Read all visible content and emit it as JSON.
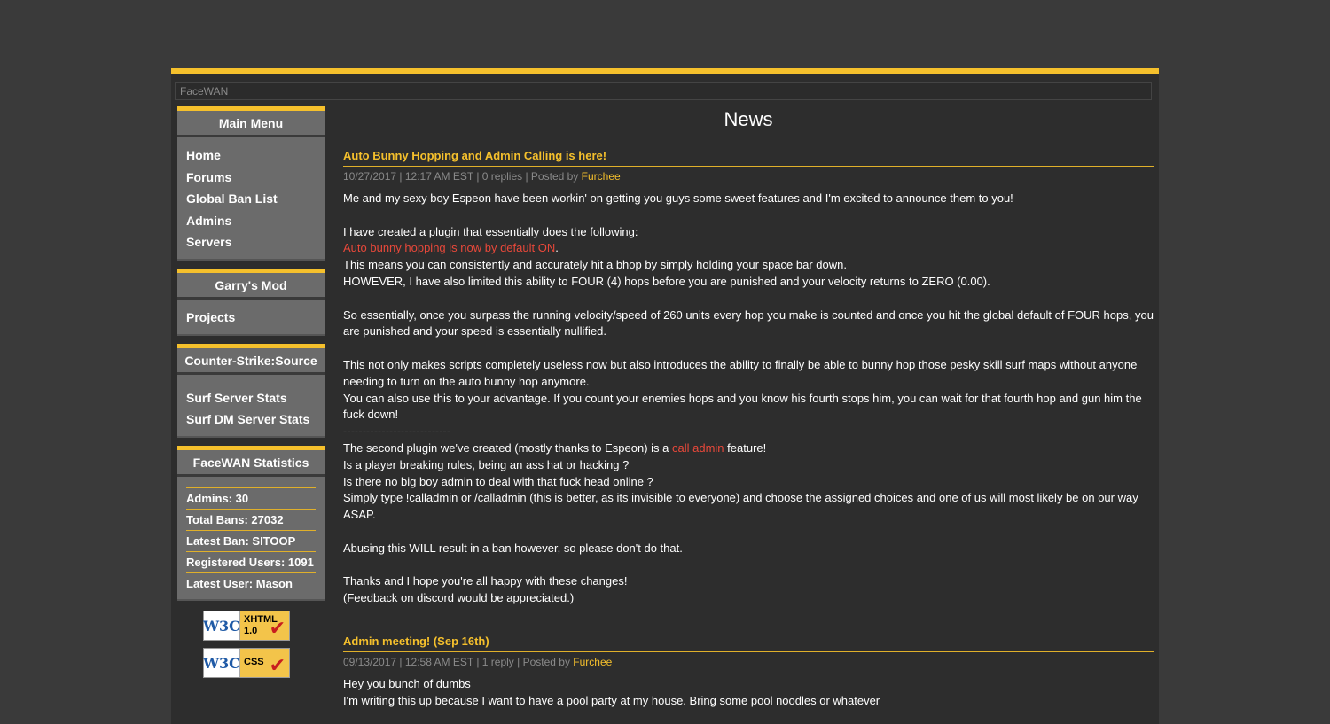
{
  "breadcrumb": "FaceWAN",
  "menus": {
    "main": {
      "title": "Main Menu",
      "items": [
        "Home",
        "Forums",
        "Global Ban List",
        "Admins",
        "Servers"
      ]
    },
    "garrys": {
      "title": "Garry's Mod",
      "items": [
        "Projects"
      ]
    },
    "css": {
      "title": "Counter-Strike:Source",
      "items": [
        "Surf Server Stats",
        "Surf DM Server Stats"
      ]
    },
    "stats": {
      "title": "FaceWAN Statistics",
      "items": [
        "Admins: 30",
        "Total Bans: 27032",
        "Latest Ban: SITOOP",
        "Registered Users: 1091",
        "Latest User: Mason"
      ]
    }
  },
  "badges": {
    "xhtml": {
      "logo": "W3C",
      "label1": "XHTML",
      "label2": "1.0"
    },
    "css": {
      "logo": "W3C",
      "label1": "CSS",
      "label2": ""
    }
  },
  "page_title": "News",
  "posts": [
    {
      "title": "Auto Bunny Hopping and Admin Calling is here!",
      "meta": "10/27/2017 | 12:17 AM EST | 0 replies | Posted by ",
      "author": "Furchee",
      "lines": {
        "p1": "Me and my sexy boy Espeon have been workin' on getting you guys some sweet features and I'm excited to announce them to you!",
        "p2": "I have created a plugin that essentially does the following:",
        "p3_red": "Auto bunny hopping is now by default ON",
        "p3_end": ".",
        "p4": "This means you can consistently and accurately hit a bhop by simply holding your space bar down.",
        "p5": "HOWEVER, I have also limited this ability to FOUR (4) hops before you are punished and your velocity returns to ZERO (0.00).",
        "p6": "So essentially, once you surpass the running velocity/speed of 260 units every hop you make is counted and once you hit the global default of FOUR hops, you are punished and your speed is essentially nullified.",
        "p7": "This not only makes scripts completely useless now but also introduces the ability to finally be able to bunny hop those pesky skill surf maps without anyone needing to turn on the auto bunny hop anymore.",
        "p8": "You can also use this to your advantage. If you count your enemies hops and you know his fourth stops him, you can wait for that fourth hop and gun him the fuck down!",
        "p9": "----------------------------",
        "p10_start": "The second plugin we've created (mostly thanks to Espeon) is a ",
        "p10_red": "call admin",
        "p10_end": " feature!",
        "p11": "Is a player breaking rules, being an ass hat or hacking ?",
        "p12": "Is there no big boy admin to deal with that fuck head online ?",
        "p13": "Simply type !calladmin or /calladmin (this is better, as its invisible to everyone) and choose the assigned choices and one of us will most likely be on our way ASAP.",
        "p14": "Abusing this WILL result in a ban however, so please don't do that.",
        "p15": "Thanks and I hope you're all happy with these changes!",
        "p16": "(Feedback on discord would be appreciated.)"
      }
    },
    {
      "title": "Admin meeting! (Sep 16th)",
      "meta": "09/13/2017 | 12:58 AM EST | 1 reply | Posted by ",
      "author": "Furchee",
      "lines": {
        "p1": "Hey you bunch of dumbs",
        "p2": "I'm writing this up because I want to have a pool party at my house. Bring some pool noodles or whatever"
      }
    }
  ]
}
